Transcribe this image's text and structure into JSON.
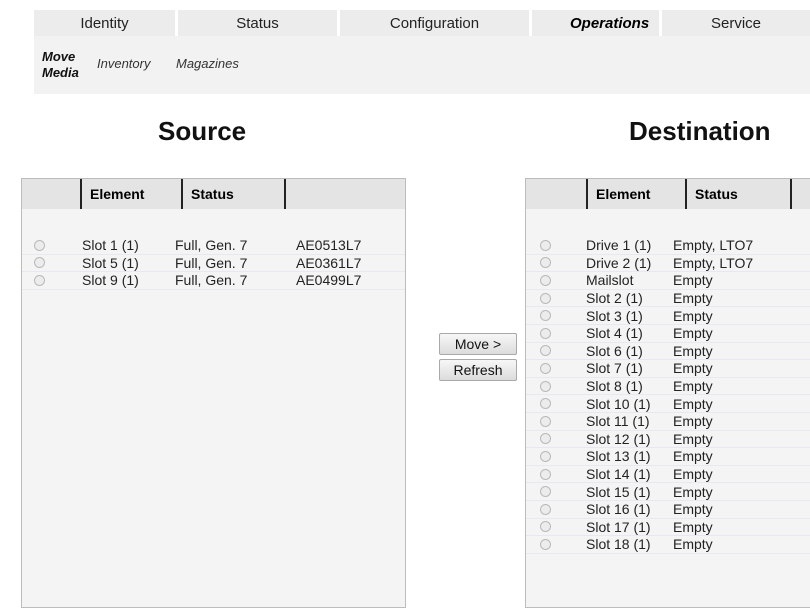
{
  "nav": {
    "tabs": [
      {
        "label": "Identity"
      },
      {
        "label": "Status"
      },
      {
        "label": "Configuration"
      },
      {
        "label": "Operations"
      },
      {
        "label": "Service"
      }
    ]
  },
  "subnav": {
    "active": "Move Media",
    "links": [
      "Inventory",
      "Magazines"
    ]
  },
  "source": {
    "title": "Source",
    "headers": [
      "Element",
      "Status"
    ],
    "rows": [
      {
        "element": "Slot 1 (1)",
        "status": "Full, Gen. 7",
        "barcode": "AE0513L7"
      },
      {
        "element": "Slot 5 (1)",
        "status": "Full, Gen. 7",
        "barcode": "AE0361L7"
      },
      {
        "element": "Slot 9 (1)",
        "status": "Full, Gen. 7",
        "barcode": "AE0499L7"
      }
    ]
  },
  "actions": {
    "move_label": "Move >",
    "refresh_label": "Refresh"
  },
  "destination": {
    "title": "Destination",
    "headers": [
      "Element",
      "Status"
    ],
    "rows": [
      {
        "element": "Drive 1 (1)",
        "status": "Empty, LTO7"
      },
      {
        "element": "Drive 2 (1)",
        "status": "Empty, LTO7"
      },
      {
        "element": "Mailslot",
        "status": "Empty"
      },
      {
        "element": "Slot 2 (1)",
        "status": "Empty"
      },
      {
        "element": "Slot 3 (1)",
        "status": "Empty"
      },
      {
        "element": "Slot 4 (1)",
        "status": "Empty"
      },
      {
        "element": "Slot 6 (1)",
        "status": "Empty"
      },
      {
        "element": "Slot 7 (1)",
        "status": "Empty"
      },
      {
        "element": "Slot 8 (1)",
        "status": "Empty"
      },
      {
        "element": "Slot 10 (1)",
        "status": "Empty"
      },
      {
        "element": "Slot 11 (1)",
        "status": "Empty"
      },
      {
        "element": "Slot 12 (1)",
        "status": "Empty"
      },
      {
        "element": "Slot 13 (1)",
        "status": "Empty"
      },
      {
        "element": "Slot 14 (1)",
        "status": "Empty"
      },
      {
        "element": "Slot 15 (1)",
        "status": "Empty"
      },
      {
        "element": "Slot 16 (1)",
        "status": "Empty"
      },
      {
        "element": "Slot 17 (1)",
        "status": "Empty"
      },
      {
        "element": "Slot 18 (1)",
        "status": "Empty"
      }
    ]
  }
}
